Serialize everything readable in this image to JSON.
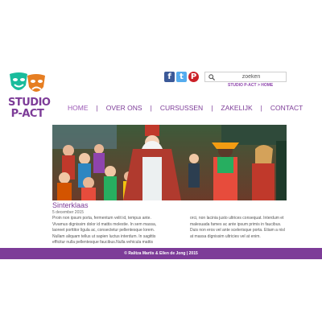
{
  "logo": {
    "line1": "STUDIO",
    "line2": "P-ACT"
  },
  "social": {
    "facebook": "f",
    "twitter": "t",
    "pinterest": "P"
  },
  "search": {
    "placeholder": "zoeken",
    "icon": "search-icon"
  },
  "breadcrumb": {
    "site": "STUDIO P-ACT",
    "separator": ">",
    "page": "HOME"
  },
  "nav": {
    "items": [
      {
        "label": "HOME",
        "active": true
      },
      {
        "label": "OVER ONS"
      },
      {
        "label": "CURSUSSEN"
      },
      {
        "label": "ZAKELIJK"
      },
      {
        "label": "CONTACT"
      }
    ],
    "separator": "|"
  },
  "article": {
    "title": "Sinterklaas",
    "date": "5 december 2015",
    "col1": "Proin non ipsum porta, fermentum velit id, tempus ante. Vivamus dignissim dolor id mattis molestie. In sem massa, laoreet porttitor ligula ac, consectetur pellentesque lorem. Nullam aliquam tellus ut sapien luctus interdum. In sagittis efficitur nulla pellentesque faucibus.Nulla vehicula mattis",
    "col2": "orci, non lacinia justo ultrices consequat. Interdum et malesuada fames ac ante ipsum primis in faucibus. Duis non eros vel ante scelerisque porta. Etiam a nisl at massa dignissim ultricies vel at enim."
  },
  "footer": {
    "text": "© Ralitza Martis & Ellen de Jong | 2015"
  },
  "colors": {
    "brand_purple": "#7d3c98",
    "mask_teal": "#1abc9c",
    "mask_orange": "#e67e22"
  }
}
